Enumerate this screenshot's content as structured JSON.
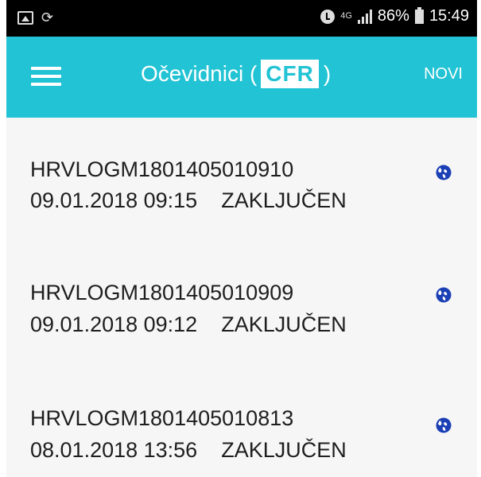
{
  "status_bar": {
    "network": "4G",
    "battery": "86%",
    "time": "15:49",
    "left_icons": [
      "gallery-icon",
      "sync-icon"
    ],
    "right_icons": [
      "alarm-icon",
      "signal-icon",
      "battery-icon"
    ]
  },
  "app_bar": {
    "title_prefix": "Očevidnici (",
    "title_badge": "CFR",
    "title_suffix": ")",
    "action_label": "NOVI",
    "background": "#22c3d4"
  },
  "records": [
    {
      "code": "HRVLOGM1801405010910",
      "datetime": "09.01.2018 09:15",
      "status": "ZAKLJUČEN",
      "icon": "globe-icon"
    },
    {
      "code": "HRVLOGM1801405010909",
      "datetime": "09.01.2018 09:12",
      "status": "ZAKLJUČEN",
      "icon": "globe-icon"
    },
    {
      "code": "HRVLOGM1801405010813",
      "datetime": "08.01.2018 13:56",
      "status": "ZAKLJUČEN",
      "icon": "globe-icon"
    }
  ]
}
